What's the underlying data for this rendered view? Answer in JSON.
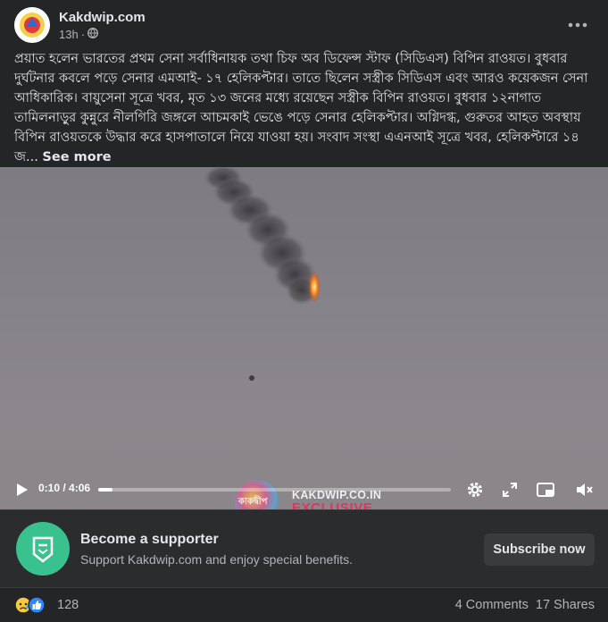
{
  "post": {
    "page_name": "Kakdwip.com",
    "time": "13h",
    "dot": "·",
    "body_text": "প্রয়াত হলেন ভারতের প্রথম সেনা সর্বাধিনায়ক তথা চিফ অব ডিফেন্স স্টাফ (সিডিএস) বিপিন রাওয়ত। বুধবার দুর্ঘটনার কবলে পড়ে সেনার এমআই- ১৭ হেলিকপ্টার। তাতে ছিলেন সস্ত্রীক সিডিএস এবং আরও কয়েকজন সেনা আধিকারিক। বায়ুসেনা সূত্রে খবর, মৃত ১৩ জনের মধ্যে রয়েছেন সস্ত্রীক বিপিন রাওয়ত। বুধবার ১২নাগাত তামিলনাড়ুর কুন্নুরে নীলগিরি জঙ্গলে আচমকাই ভেঙে পড়ে সেনার হেলিকপ্টার। অগ্নিদগ্ধ, গুরুতর আহত অবস্থায় বিপিন রাওয়তকে উদ্ধার করে হাসপাতালে নিয়ে যাওয়া হয়। সংবাদ সংস্থা এএনআই সূত্রে খবর, হেলিকপ্টারে ১৪ জ...",
    "see_more": "See more"
  },
  "video": {
    "watermark_site": "KAKDWIP.CO.IN",
    "watermark_exclusive": "EXCLUSIVE",
    "watermark_logo_text": "কাকদ্বীপ",
    "time_display": "0:10 / 4:06",
    "progress": 0.04
  },
  "supporter": {
    "title": "Become a supporter",
    "subtitle": "Support Kakdwip.com and enjoy special benefits.",
    "button": "Subscribe now"
  },
  "footer": {
    "reaction_count": "128",
    "comments": "4 Comments",
    "shares": "17 Shares"
  },
  "colors": {
    "background": "#242526",
    "supporter_icon": "#3ac28e",
    "like_blue": "#2d88ff",
    "sad_yellow": "#f7c93e",
    "exclusive_red": "#e0355f"
  }
}
